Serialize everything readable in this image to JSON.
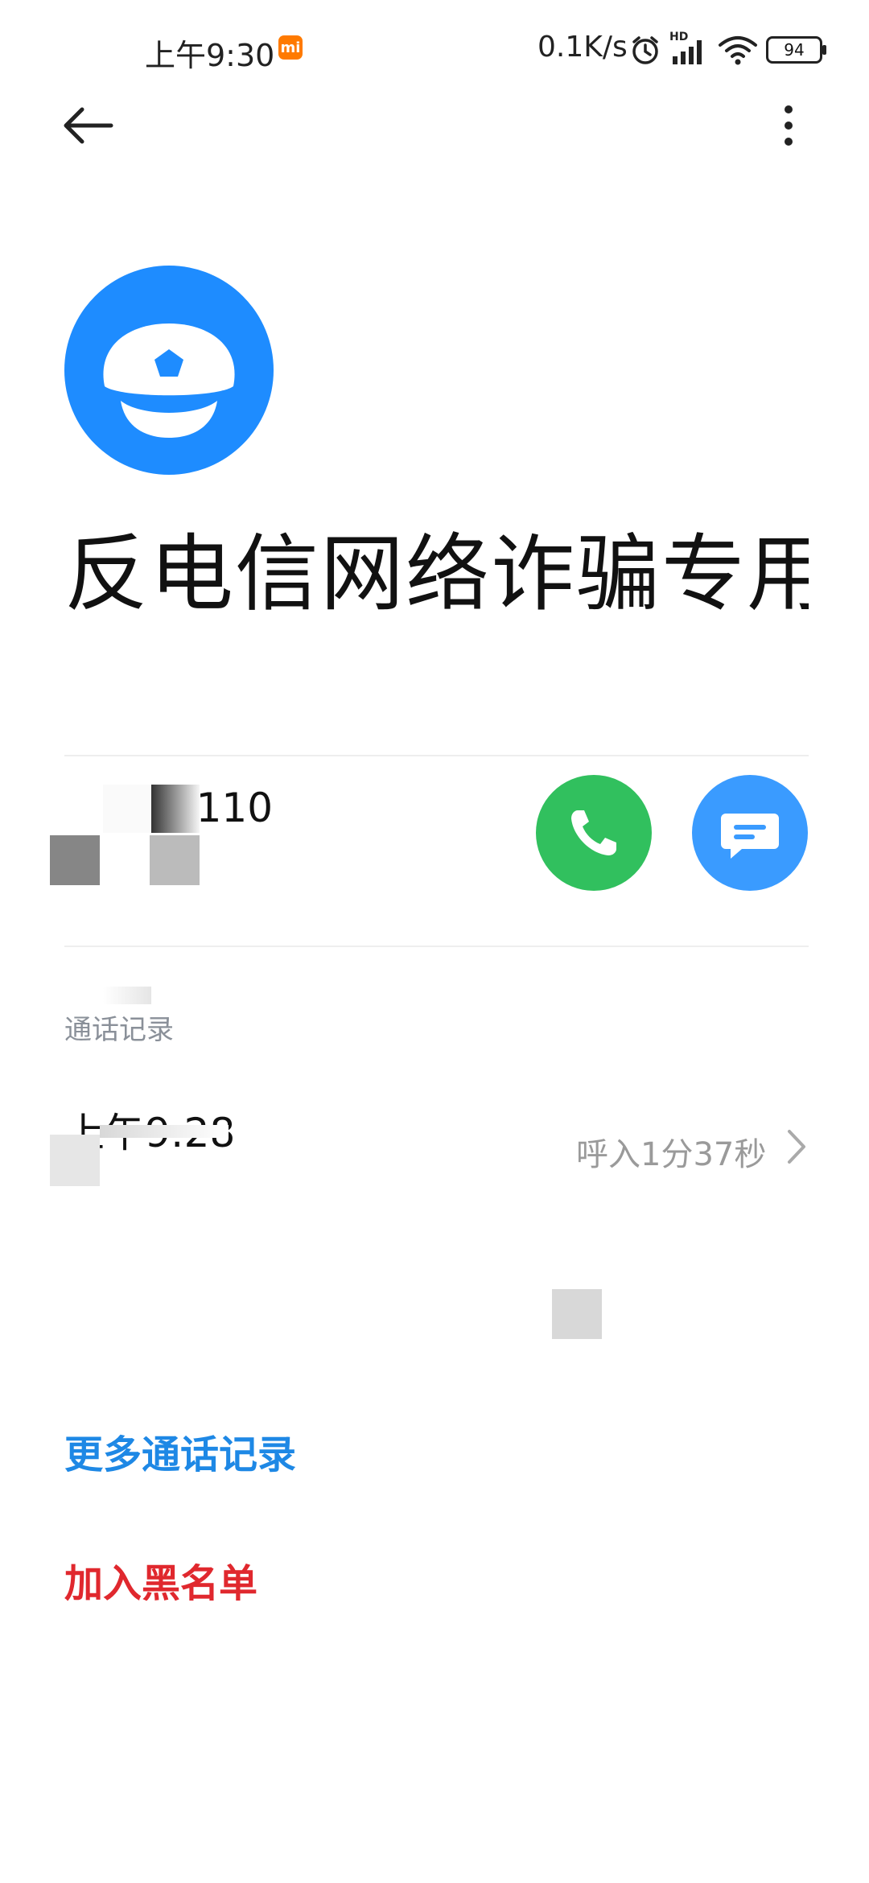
{
  "status_bar": {
    "time": "上午9:30",
    "mi_badge": "mi",
    "network_speed": "0.1K/s",
    "signal_label": "HD",
    "battery": "94",
    "icons": [
      "alarm-icon",
      "signal-icon",
      "wifi-icon",
      "battery-icon"
    ]
  },
  "header": {
    "back_icon": "arrow-left-icon",
    "more_icon": "more-vert-icon"
  },
  "contact": {
    "avatar_icon": "police-cap-icon",
    "avatar_color": "#1e8cff",
    "name": "反电信网络诈骗专用",
    "number": "96110",
    "call_color": "#31c05e",
    "message_color": "#3a9bff"
  },
  "call_log": {
    "section_label": "通话记录",
    "entries": [
      {
        "time": "上午9:28",
        "detail": "呼入1分37秒"
      }
    ]
  },
  "actions": {
    "more_records": "更多通话记录",
    "blacklist": "加入黑名单"
  },
  "colors": {
    "link_blue": "#1e88e5",
    "danger_red": "#e0282e"
  }
}
